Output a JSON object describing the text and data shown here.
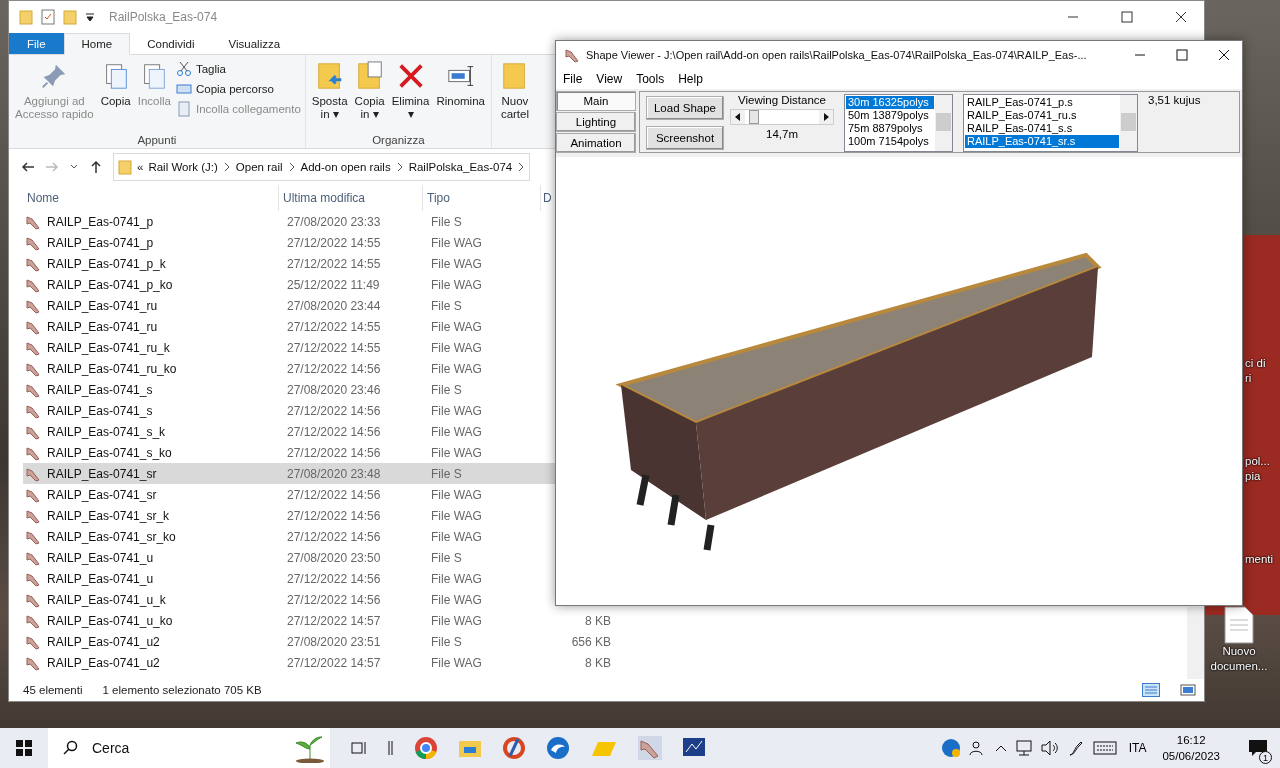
{
  "explorer": {
    "title": "RailPolska_Eas-074",
    "ribbon_tabs": [
      {
        "label": "File",
        "kind": "file",
        "selected": false
      },
      {
        "label": "Home",
        "kind": "tab",
        "selected": true
      },
      {
        "label": "Condividi",
        "kind": "tab",
        "selected": false
      },
      {
        "label": "Visualizza",
        "kind": "tab",
        "selected": false
      }
    ],
    "groups": [
      {
        "label": "Appunti",
        "large": [
          {
            "lines": [
              "Aggiungi ad",
              "Accesso rapido"
            ],
            "disabled": true
          },
          {
            "lines": [
              "Copia"
            ],
            "disabled": false
          },
          {
            "lines": [
              "Incolla"
            ],
            "disabled": true
          }
        ],
        "small": [
          {
            "label": "Taglia",
            "disabled": false
          },
          {
            "label": "Copia percorso",
            "disabled": false
          },
          {
            "label": "Incolla collegamento",
            "disabled": true
          }
        ]
      },
      {
        "label": "Organizza",
        "large": [
          {
            "lines": [
              "Sposta",
              "in ▾"
            ],
            "disabled": false
          },
          {
            "lines": [
              "Copia",
              "in ▾"
            ],
            "disabled": false
          },
          {
            "lines": [
              "Elimina",
              "▾"
            ],
            "disabled": false
          },
          {
            "lines": [
              "Rinomina"
            ],
            "disabled": false
          }
        ]
      }
    ],
    "new_folder_button": {
      "lines": [
        "Nuov",
        "cartel"
      ]
    },
    "breadcrumb": [
      "«",
      "Rail Work (J:)",
      "Open rail",
      "Add-on open rails",
      "RailPolska_Eas-074"
    ],
    "columns": [
      "Nome",
      "Ultima modifica",
      "Tipo",
      "D"
    ],
    "rows": [
      {
        "name": "RAILP_Eas-0741_p",
        "date": "27/08/2020 23:33",
        "type": "File S",
        "selected": false
      },
      {
        "name": "RAILP_Eas-0741_p",
        "date": "27/12/2022 14:55",
        "type": "File WAG",
        "selected": false
      },
      {
        "name": "RAILP_Eas-0741_p_k",
        "date": "27/12/2022 14:55",
        "type": "File WAG",
        "selected": false
      },
      {
        "name": "RAILP_Eas-0741_p_ko",
        "date": "25/12/2022 11:49",
        "type": "File WAG",
        "selected": false
      },
      {
        "name": "RAILP_Eas-0741_ru",
        "date": "27/08/2020 23:44",
        "type": "File S",
        "selected": false
      },
      {
        "name": "RAILP_Eas-0741_ru",
        "date": "27/12/2022 14:55",
        "type": "File WAG",
        "selected": false
      },
      {
        "name": "RAILP_Eas-0741_ru_k",
        "date": "27/12/2022 14:55",
        "type": "File WAG",
        "selected": false
      },
      {
        "name": "RAILP_Eas-0741_ru_ko",
        "date": "27/12/2022 14:56",
        "type": "File WAG",
        "selected": false
      },
      {
        "name": "RAILP_Eas-0741_s",
        "date": "27/08/2020 23:46",
        "type": "File S",
        "selected": false
      },
      {
        "name": "RAILP_Eas-0741_s",
        "date": "27/12/2022 14:56",
        "type": "File WAG",
        "selected": false
      },
      {
        "name": "RAILP_Eas-0741_s_k",
        "date": "27/12/2022 14:56",
        "type": "File WAG",
        "selected": false
      },
      {
        "name": "RAILP_Eas-0741_s_ko",
        "date": "27/12/2022 14:56",
        "type": "File WAG",
        "selected": false
      },
      {
        "name": "RAILP_Eas-0741_sr",
        "date": "27/08/2020 23:48",
        "type": "File S",
        "selected": true
      },
      {
        "name": "RAILP_Eas-0741_sr",
        "date": "27/12/2022 14:56",
        "type": "File WAG",
        "selected": false
      },
      {
        "name": "RAILP_Eas-0741_sr_k",
        "date": "27/12/2022 14:56",
        "type": "File WAG",
        "selected": false
      },
      {
        "name": "RAILP_Eas-0741_sr_ko",
        "date": "27/12/2022 14:56",
        "type": "File WAG",
        "selected": false
      },
      {
        "name": "RAILP_Eas-0741_u",
        "date": "27/08/2020 23:50",
        "type": "File S",
        "selected": false
      },
      {
        "name": "RAILP_Eas-0741_u",
        "date": "27/12/2022 14:56",
        "type": "File WAG",
        "selected": false
      },
      {
        "name": "RAILP_Eas-0741_u_k",
        "date": "27/12/2022 14:56",
        "type": "File WAG",
        "selected": false
      },
      {
        "name": "RAILP_Eas-0741_u_ko",
        "date": "27/12/2022 14:57",
        "type": "File WAG",
        "size": "8 KB",
        "selected": false
      },
      {
        "name": "RAILP_Eas-0741_u2",
        "date": "27/08/2020 23:51",
        "type": "File S",
        "size": "656 KB",
        "selected": false
      },
      {
        "name": "RAILP_Eas-0741_u2",
        "date": "27/12/2022 14:57",
        "type": "File WAG",
        "size": "8 KB",
        "selected": false
      }
    ],
    "status": [
      "45 elementi",
      "1 elemento selezionato  705 KB"
    ]
  },
  "shape_viewer": {
    "title": "Shape Viewer - J:\\Open rail\\Add-on open rails\\RailPolska_Eas-074\\RailPolska_Eas-074\\RAILP_Eas-...",
    "menu": [
      "File",
      "View",
      "Tools",
      "Help"
    ],
    "side_tabs": [
      {
        "label": "Main",
        "selected": true
      },
      {
        "label": "Lighting",
        "selected": false
      },
      {
        "label": "Animation",
        "selected": false
      }
    ],
    "buttons": [
      "Load Shape",
      "Screenshot"
    ],
    "viewing_distance": {
      "label": "Viewing Distance",
      "level": 0.06,
      "reading": "14,7m"
    },
    "lods": [
      {
        "label": "30m 16325polys",
        "selected": true
      },
      {
        "label": "50m 13879polys",
        "selected": false
      },
      {
        "label": "75m 8879polys",
        "selected": false
      },
      {
        "label": "100m 7154polys",
        "selected": false
      }
    ],
    "shapes": [
      {
        "label": "RAILP_Eas-0741_p.s",
        "selected": false
      },
      {
        "label": "RAILP_Eas-0741_ru.s",
        "selected": false
      },
      {
        "label": "RAILP_Eas-0741_s.s",
        "selected": false
      },
      {
        "label": "RAILP_Eas-0741_sr.s",
        "selected": true
      }
    ],
    "fps": "3,51 kujus"
  },
  "desktop_icons": [
    {
      "lines": [
        "ci di",
        "ri"
      ]
    },
    {
      "lines": [
        "pol...",
        "pia"
      ]
    },
    {
      "lines": [
        "menti"
      ]
    },
    {
      "lines": [
        "Nuovo",
        "documen..."
      ]
    }
  ],
  "taskbar": {
    "search": "Cerca",
    "language": "ITA",
    "time": "16:12",
    "date": "05/06/2023",
    "notifications": "1"
  }
}
